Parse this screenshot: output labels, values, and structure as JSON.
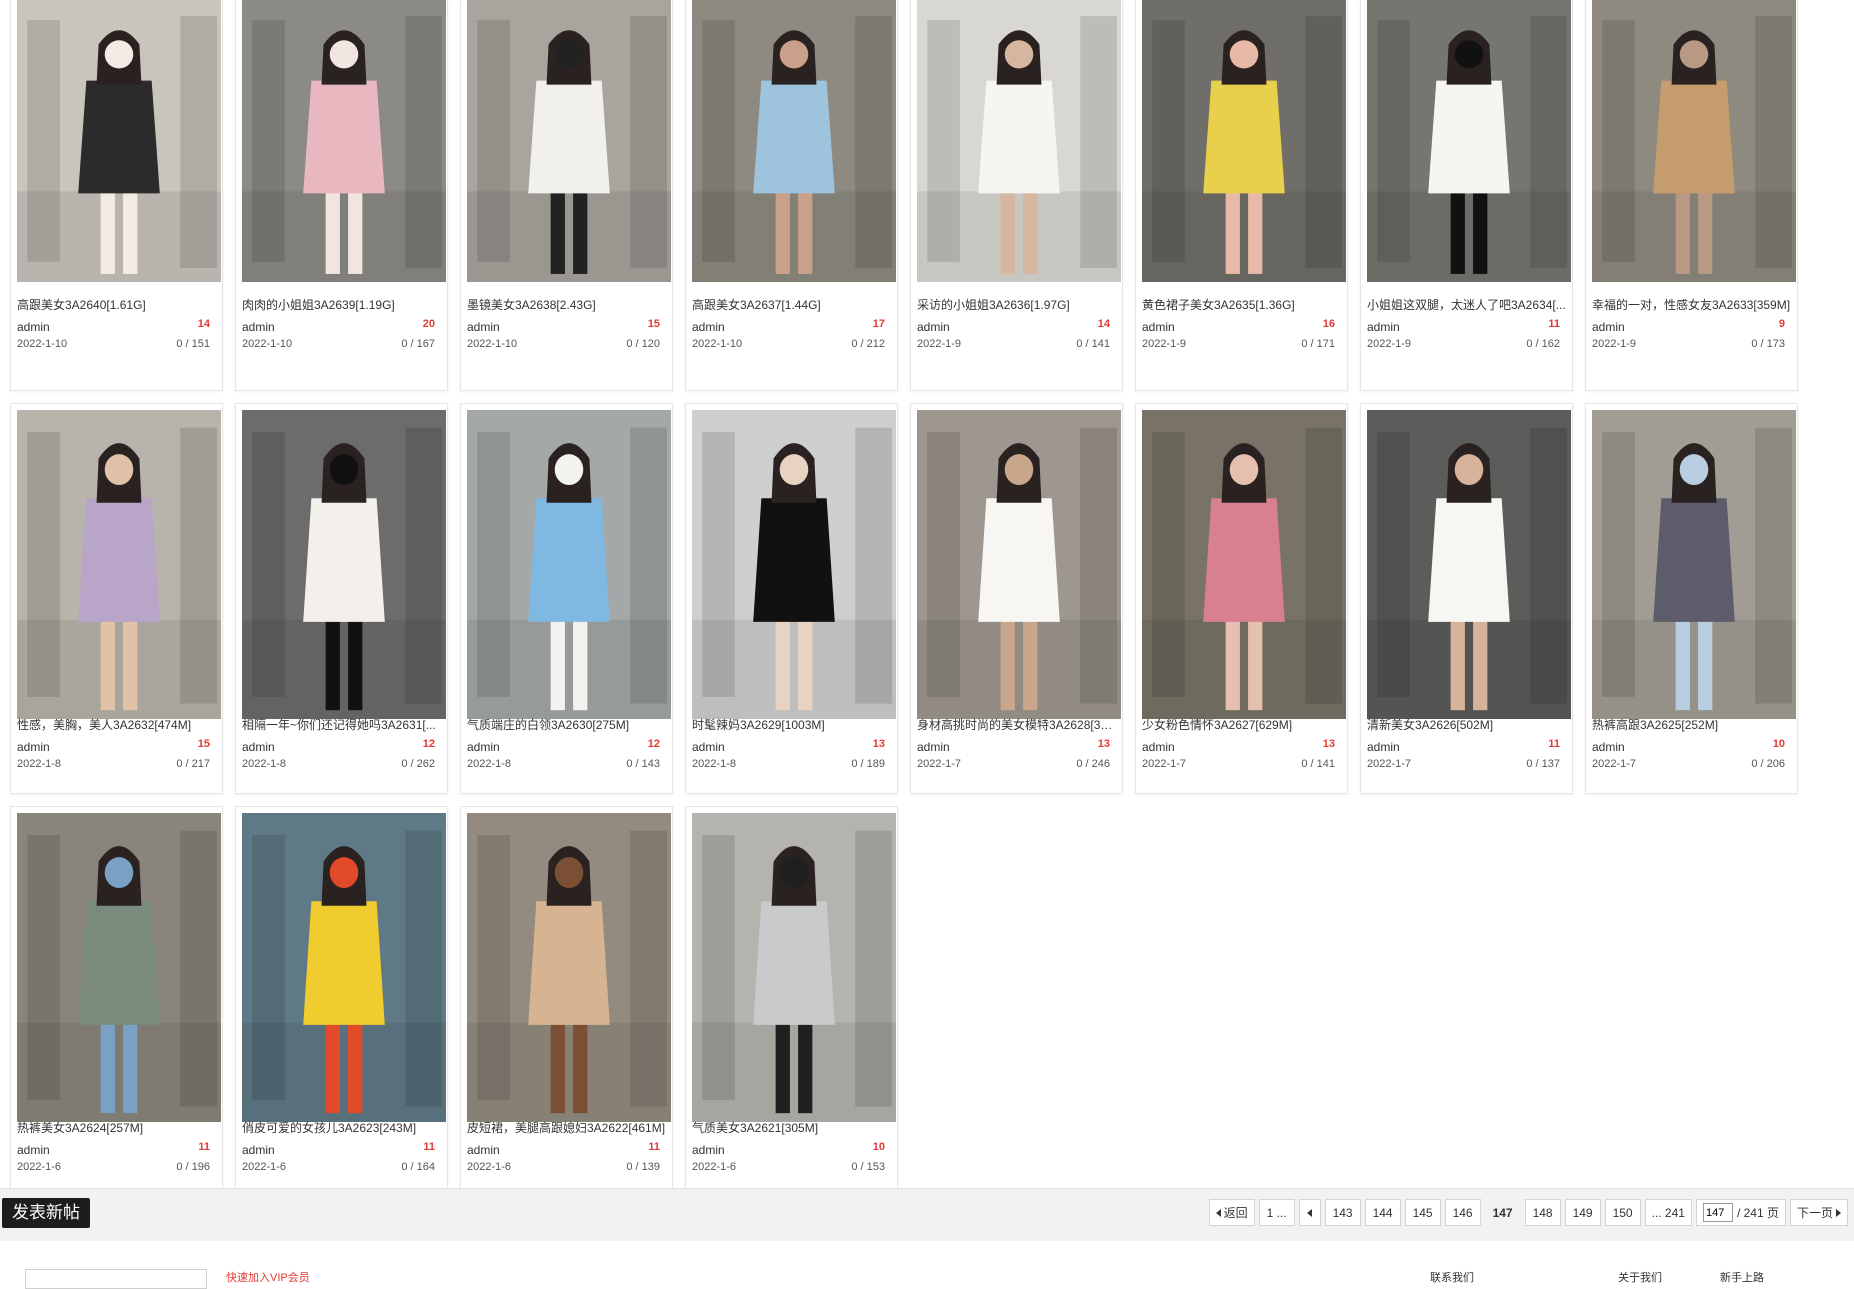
{
  "posts": [
    {
      "title": "高跟美女3A2640[1.61G]",
      "author": "admin",
      "likes": "14",
      "date": "2022-1-10",
      "stats": "0 / 151"
    },
    {
      "title": "肉肉的小姐姐3A2639[1.19G]",
      "author": "admin",
      "likes": "20",
      "date": "2022-1-10",
      "stats": "0 / 167"
    },
    {
      "title": "墨镜美女3A2638[2.43G]",
      "author": "admin",
      "likes": "15",
      "date": "2022-1-10",
      "stats": "0 / 120"
    },
    {
      "title": "高跟美女3A2637[1.44G]",
      "author": "admin",
      "likes": "17",
      "date": "2022-1-10",
      "stats": "0 / 212"
    },
    {
      "title": "采访的小姐姐3A2636[1.97G]",
      "author": "admin",
      "likes": "14",
      "date": "2022-1-9",
      "stats": "0 / 141"
    },
    {
      "title": "黄色裙子美女3A2635[1.36G]",
      "author": "admin",
      "likes": "16",
      "date": "2022-1-9",
      "stats": "0 / 171"
    },
    {
      "title": "小姐姐这双腿，太迷人了吧3A2634[...",
      "author": "admin",
      "likes": "11",
      "date": "2022-1-9",
      "stats": "0 / 162"
    },
    {
      "title": "幸福的一对，性感女友3A2633[359M]",
      "author": "admin",
      "likes": "9",
      "date": "2022-1-9",
      "stats": "0 / 173"
    },
    {
      "title": "性感，美胸，美人3A2632[474M]",
      "author": "admin",
      "likes": "15",
      "date": "2022-1-8",
      "stats": "0 / 217"
    },
    {
      "title": "相隔一年~你们还记得她吗3A2631[...",
      "author": "admin",
      "likes": "12",
      "date": "2022-1-8",
      "stats": "0 / 262"
    },
    {
      "title": "气质端庄的白领3A2630[275M]",
      "author": "admin",
      "likes": "12",
      "date": "2022-1-8",
      "stats": "0 / 143"
    },
    {
      "title": "时髦辣妈3A2629[1003M]",
      "author": "admin",
      "likes": "13",
      "date": "2022-1-8",
      "stats": "0 / 189"
    },
    {
      "title": "身材高挑时尚的美女模特3A2628[32...",
      "author": "admin",
      "likes": "13",
      "date": "2022-1-7",
      "stats": "0 / 246"
    },
    {
      "title": "少女粉色情怀3A2627[629M]",
      "author": "admin",
      "likes": "13",
      "date": "2022-1-7",
      "stats": "0 / 141"
    },
    {
      "title": "清新美女3A2626[502M]",
      "author": "admin",
      "likes": "11",
      "date": "2022-1-7",
      "stats": "0 / 137"
    },
    {
      "title": "热裤高跟3A2625[252M]",
      "author": "admin",
      "likes": "10",
      "date": "2022-1-7",
      "stats": "0 / 206"
    },
    {
      "title": "热裤美女3A2624[257M]",
      "author": "admin",
      "likes": "11",
      "date": "2022-1-6",
      "stats": "0 / 196"
    },
    {
      "title": "俏皮可爱的女孩儿3A2623[243M]",
      "author": "admin",
      "likes": "11",
      "date": "2022-1-6",
      "stats": "0 / 164"
    },
    {
      "title": "皮短裙，美腿高跟媳妇3A2622[461M]",
      "author": "admin",
      "likes": "11",
      "date": "2022-1-6",
      "stats": "0 / 139"
    },
    {
      "title": "气质美女3A2621[305M]",
      "author": "admin",
      "likes": "10",
      "date": "2022-1-6",
      "stats": "0 / 153"
    }
  ],
  "thumb_palette": [
    [
      "#c9c4bc",
      "#2b2b2b",
      "#f4ece4"
    ],
    [
      "#8c8a86",
      "#e8b7c0",
      "#f0e6df"
    ],
    [
      "#a8a49e",
      "#f2f0ec",
      "#222222"
    ],
    [
      "#8e8a82",
      "#9ec3dc",
      "#c9a089"
    ],
    [
      "#d9d7d2",
      "#f7f5f1",
      "#d5b7a0"
    ],
    [
      "#6f6e69",
      "#e9d04c",
      "#e8b9a7"
    ],
    [
      "#767670",
      "#f5f5f2",
      "#111111"
    ],
    [
      "#8f8a80",
      "#c59c6d",
      "#b89a84"
    ],
    [
      "#b8b3ab",
      "#b9a5c7",
      "#e0c2a8"
    ],
    [
      "#6c6c6c",
      "#f3f0ec",
      "#111111"
    ],
    [
      "#a4a8a8",
      "#7fb8e0",
      "#f2f2ee"
    ],
    [
      "#cfcfcf",
      "#111111",
      "#e8d3c3"
    ],
    [
      "#9e978f",
      "#f7f6f3",
      "#c8a78d"
    ],
    [
      "#787366",
      "#d88090",
      "#e6c0ae"
    ],
    [
      "#5c5c5a",
      "#f6f6f3",
      "#d8b39b"
    ],
    [
      "#a29d94",
      "#5c5c6a",
      "#b9cde0"
    ],
    [
      "#8a857c",
      "#7a8a7c",
      "#7aa0c4"
    ],
    [
      "#5f7a86",
      "#f1cc2e",
      "#e24b2a"
    ],
    [
      "#938b7f",
      "#d7b491",
      "#7a4f33"
    ],
    [
      "#b5b3ad",
      "#c9cacc",
      "#1f1f1f"
    ]
  ],
  "toolbar": {
    "new_post": "发表新帖"
  },
  "pager": {
    "back": "返回",
    "first": "1 ...",
    "pages": [
      "143",
      "144",
      "145",
      "146",
      "147",
      "148",
      "149",
      "150"
    ],
    "current": "147",
    "last": "... 241",
    "input_value": "147",
    "total": "/ 241 页",
    "next": "下一页"
  },
  "footer": {
    "left_link": "快速加入VIP会员",
    "links": [
      "联系我们",
      "关于我们",
      "新手上路"
    ]
  }
}
